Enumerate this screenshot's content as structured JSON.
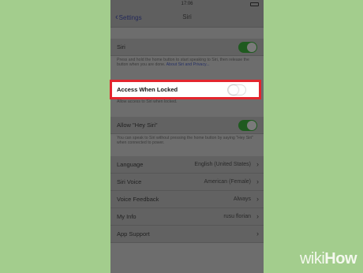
{
  "status_bar": {
    "time": "17:06"
  },
  "nav": {
    "back_label": "Settings",
    "title": "Siri"
  },
  "siri_section": {
    "siri_label": "Siri",
    "siri_on": true,
    "footnote": "Press and hold the home button to start speaking to Siri, then release the button when you are done.",
    "footnote_link": "About Siri and Privacy..."
  },
  "locked_section": {
    "access_when_locked_label": "Access When Locked",
    "access_when_locked_on": false,
    "footnote": "Allow access to Siri when locked."
  },
  "hey_siri_section": {
    "label": "Allow \"Hey Siri\"",
    "on": true,
    "footnote": "You can speak to Siri without pressing the home button by saying \"Hey Siri\" when connected to power."
  },
  "settings_list": [
    {
      "label": "Language",
      "value": "English (United States)"
    },
    {
      "label": "Siri Voice",
      "value": "American (Female)"
    },
    {
      "label": "Voice Feedback",
      "value": "Always"
    },
    {
      "label": "My Info",
      "value": "rusu florian"
    },
    {
      "label": "App Support",
      "value": ""
    }
  ],
  "icons": {
    "back": "chevron-left-icon",
    "disclosure": "chevron-right-icon"
  },
  "colors": {
    "background": "#a3cd8d",
    "highlight_border": "#e3252d",
    "toggle_on": "#1f5a1f"
  },
  "watermark": {
    "wiki": "wiki",
    "how": "How"
  }
}
